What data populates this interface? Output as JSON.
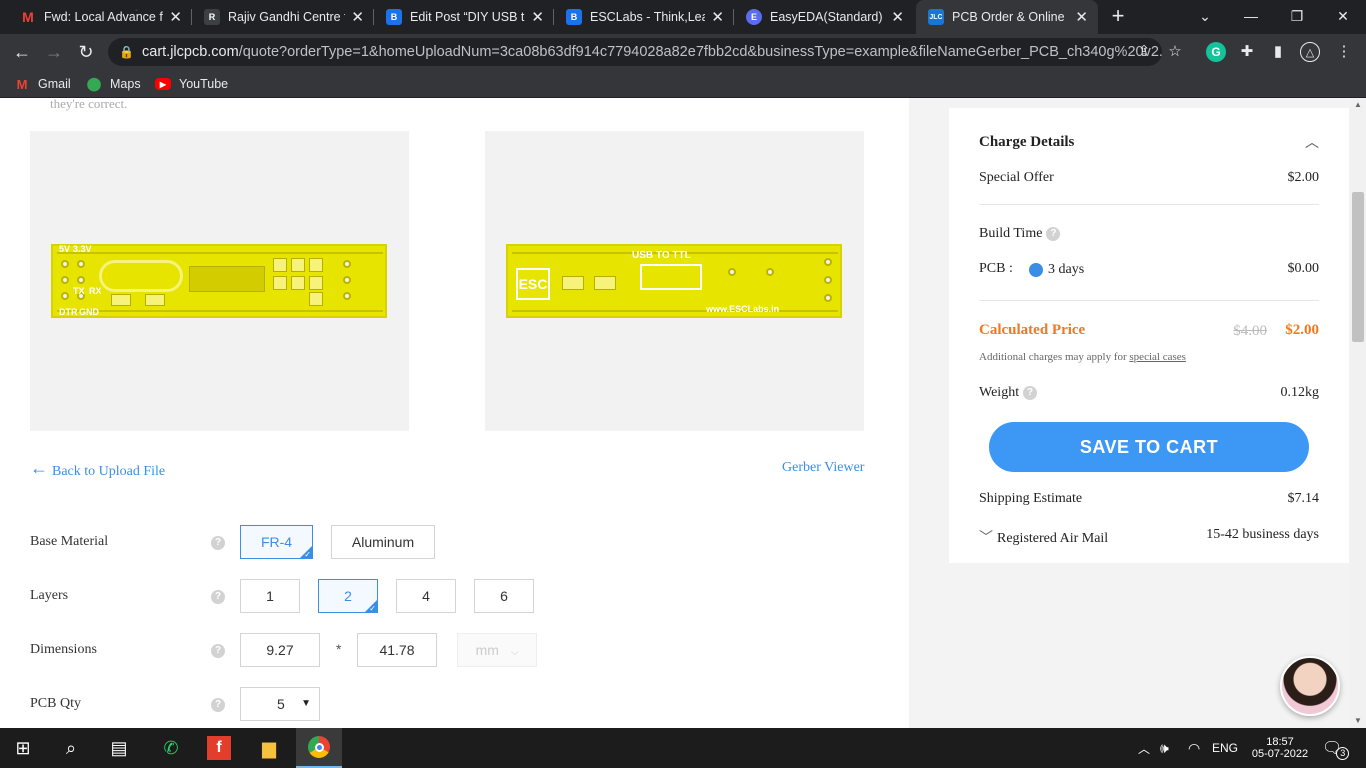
{
  "browser": {
    "tabs": [
      {
        "title": "Fwd: Local Advance fo",
        "icon": "gmail-icon",
        "color": "#ea4335",
        "glyph": "M",
        "active": false
      },
      {
        "title": "Rajiv Gandhi Centre fo",
        "icon": "site-logo-icon",
        "color": "#3c4043",
        "glyph": "R",
        "active": false
      },
      {
        "title": "Edit Post “DIY USB to",
        "icon": "blogger-icon",
        "color": "#1a73e8",
        "glyph": "B",
        "active": false
      },
      {
        "title": "ESCLabs - Think,Learn",
        "icon": "blogger-icon",
        "color": "#1a73e8",
        "glyph": "B",
        "active": false
      },
      {
        "title": "EasyEDA(Standard) - A",
        "icon": "easyeda-icon",
        "color": "#5a6cf0",
        "glyph": "E",
        "active": false
      },
      {
        "title": "PCB Order & Online P",
        "icon": "jlc-icon",
        "color": "#1677d6",
        "glyph": "JLC",
        "active": true
      }
    ],
    "url_host": "cart.jlcpcb.com",
    "url_path": "/quote?orderType=1&homeUploadNum=3ca08b63df914c7794028a82e7fbb2cd&businessType=example&fileNameGerber_PCB_ch340g%20v2...",
    "bookmarks": [
      {
        "label": "Gmail",
        "icon": "gmail-icon"
      },
      {
        "label": "Maps",
        "icon": "maps-icon"
      },
      {
        "label": "YouTube",
        "icon": "youtube-icon"
      }
    ]
  },
  "page": {
    "clipped_text": "they're correct.",
    "pcb_top_silk": [
      "5V",
      "3.3V",
      "TX",
      "RX",
      "DTR",
      "GND"
    ],
    "pcb_bottom_silk": [
      "ESC",
      "USB TO TTL",
      "www.ESCLabs.in"
    ],
    "back_link": "Back to Upload File",
    "gerber_viewer": "Gerber Viewer",
    "options": {
      "base_material_label": "Base Material",
      "base_material": [
        "FR-4",
        "Aluminum"
      ],
      "layers_label": "Layers",
      "layers": [
        "1",
        "2",
        "4",
        "6"
      ],
      "dimensions_label": "Dimensions",
      "dim_width": "9.27",
      "dim_sep": "*",
      "dim_height": "41.78",
      "dim_unit": "mm",
      "qty_label": "PCB Qty",
      "qty": "5"
    }
  },
  "charges": {
    "title": "Charge Details",
    "special_offer_label": "Special Offer",
    "special_offer_value": "$2.00",
    "build_time_label": "Build Time",
    "pcb_label": "PCB :",
    "pcb_option": "3 days",
    "pcb_value": "$0.00",
    "calc_label": "Calculated Price",
    "old_price": "$4.00",
    "new_price": "$2.00",
    "note_prefix": "Additional charges may apply for",
    "note_link": "special cases",
    "weight_label": "Weight",
    "weight_value": "0.12kg",
    "save_button": "SAVE TO CART",
    "shipping_label": "Shipping Estimate",
    "shipping_value": "$7.14",
    "shipping_method": "Registered Air Mail",
    "shipping_days": "15-42 business days"
  },
  "taskbar": {
    "language": "ENG",
    "time": "18:57",
    "date": "05-07-2022",
    "notifications": "3"
  },
  "colors": {
    "accent": "#3a8ee6",
    "price_orange": "#f0781e",
    "button_blue": "#3d98f5",
    "pcb_yellow": "#e7e400"
  }
}
